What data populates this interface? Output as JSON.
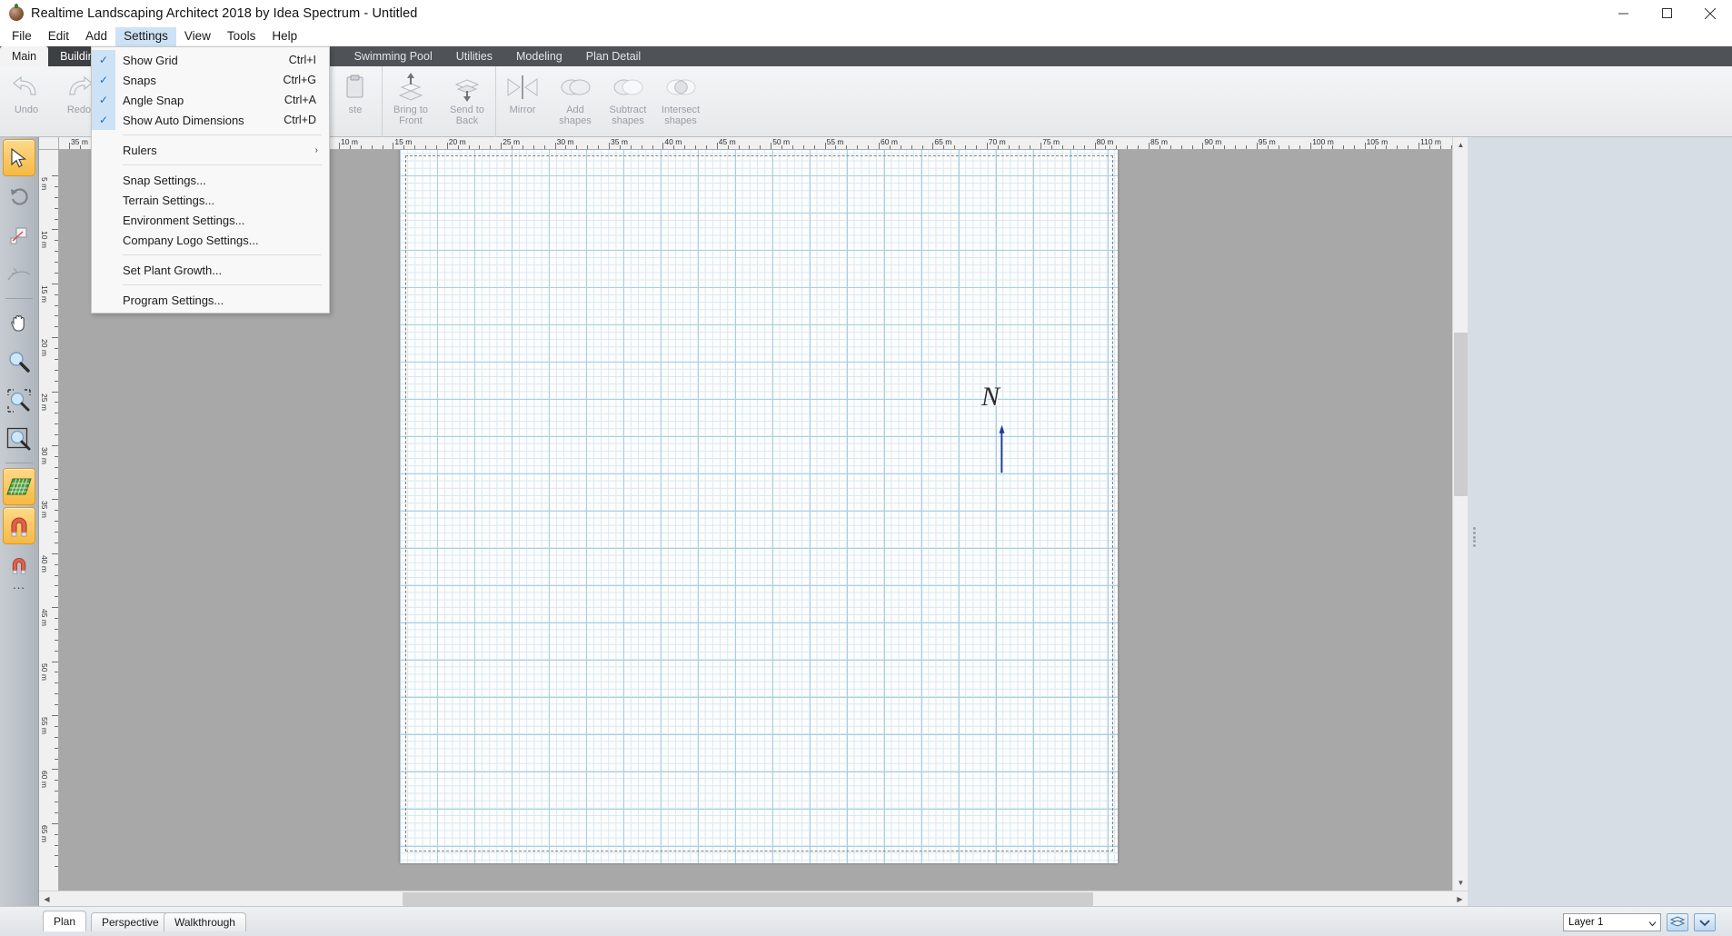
{
  "window": {
    "title": "Realtime Landscaping Architect 2018 by Idea Spectrum - Untitled",
    "app_icon": "tree-icon",
    "minimize": "─",
    "maximize": "☐",
    "close": "✕"
  },
  "menubar": {
    "items": [
      {
        "label": "File",
        "active": false
      },
      {
        "label": "Edit",
        "active": false
      },
      {
        "label": "Add",
        "active": false
      },
      {
        "label": "Settings",
        "active": true
      },
      {
        "label": "View",
        "active": false
      },
      {
        "label": "Tools",
        "active": false
      },
      {
        "label": "Help",
        "active": false
      }
    ]
  },
  "settings_menu": {
    "items": [
      {
        "label": "Show Grid",
        "accel": "Ctrl+I",
        "checked": true,
        "type": "check"
      },
      {
        "label": "Snaps",
        "accel": "Ctrl+G",
        "checked": true,
        "type": "check"
      },
      {
        "label": "Angle Snap",
        "accel": "Ctrl+A",
        "checked": true,
        "type": "check"
      },
      {
        "label": "Show Auto Dimensions",
        "accel": "Ctrl+D",
        "checked": true,
        "type": "check"
      },
      {
        "type": "separator"
      },
      {
        "label": "Rulers",
        "accel": "",
        "checked": false,
        "type": "submenu",
        "submenu_arrow": "›"
      },
      {
        "type": "separator"
      },
      {
        "label": "Snap Settings...",
        "accel": "",
        "checked": false,
        "type": "item"
      },
      {
        "label": "Terrain Settings...",
        "accel": "",
        "checked": false,
        "type": "item"
      },
      {
        "label": "Environment Settings...",
        "accel": "",
        "checked": false,
        "type": "item"
      },
      {
        "label": "Company Logo Settings...",
        "accel": "",
        "checked": false,
        "type": "item"
      },
      {
        "type": "separator"
      },
      {
        "label": "Set Plant Growth...",
        "accel": "",
        "checked": false,
        "type": "item"
      },
      {
        "type": "separator"
      },
      {
        "label": "Program Settings...",
        "accel": "",
        "checked": false,
        "type": "item"
      }
    ]
  },
  "ribbon": {
    "tabs": [
      {
        "label": "Main",
        "state": "selected"
      },
      {
        "label": "Building",
        "state": "sub"
      },
      {
        "label": "Swimming Pool",
        "state": "normal"
      },
      {
        "label": "Utilities",
        "state": "normal"
      },
      {
        "label": "Modeling",
        "state": "normal"
      },
      {
        "label": "Plan Detail",
        "state": "normal"
      }
    ],
    "groups": [
      {
        "buttons": [
          {
            "label": "Undo",
            "icon": "undo-arrow-icon"
          },
          {
            "label": "Redo",
            "icon": "redo-arrow-icon"
          }
        ]
      },
      {
        "buttons": [
          {
            "label": "Paste",
            "short_label": "ste",
            "icon": "paste-icon"
          }
        ]
      },
      {
        "buttons": [
          {
            "label": "Bring to Front",
            "line1": "Bring to",
            "line2": "Front",
            "icon": "bring-to-front-icon"
          },
          {
            "label": "Send to Back",
            "line1": "Send to",
            "line2": "Back",
            "icon": "send-to-back-icon"
          }
        ]
      },
      {
        "buttons": [
          {
            "label": "Mirror",
            "line1": "Mirror",
            "line2": "",
            "icon": "mirror-icon"
          },
          {
            "label": "Add shapes",
            "line1": "Add",
            "line2": "shapes",
            "icon": "add-shapes-icon"
          },
          {
            "label": "Subtract shapes",
            "line1": "Subtract",
            "line2": "shapes",
            "icon": "subtract-shapes-icon"
          },
          {
            "label": "Intersect shapes",
            "line1": "Intersect",
            "line2": "shapes",
            "icon": "intersect-shapes-icon"
          }
        ]
      }
    ]
  },
  "left_toolbar": {
    "tools": [
      {
        "name": "select-arrow-tool",
        "selected": true
      },
      {
        "name": "rotate-tool",
        "selected": false
      },
      {
        "name": "resize-tool",
        "selected": false
      },
      {
        "name": "curve-tool",
        "selected": false
      },
      {
        "name": "pan-hand-tool",
        "selected": false
      },
      {
        "name": "zoom-tool",
        "selected": false
      },
      {
        "name": "zoom-window-tool",
        "selected": false
      },
      {
        "name": "zoom-extents-tool",
        "selected": false
      },
      {
        "name": "grid-tool",
        "selected": true
      },
      {
        "name": "magnet-snap-tool",
        "selected": true
      },
      {
        "name": "magnet-more-tool",
        "selected": false
      }
    ],
    "more_label": "..."
  },
  "ruler_h": {
    "unit": "m",
    "labels": [
      "35 m",
      "40 m",
      "45 m",
      "50 m",
      "5 m",
      "10 m",
      "15 m",
      "20 m",
      "25 m",
      "30 m",
      "35 m",
      "40 m",
      "45 m",
      "50 m",
      "55 m",
      "60 m",
      "65 m",
      "70 m",
      "75 m",
      "80 m",
      "85 m",
      "90 m",
      "95 m",
      "100 m",
      "105 m",
      "110 m"
    ]
  },
  "ruler_v": {
    "unit": "m",
    "labels": [
      "5 m",
      "10 m",
      "15 m",
      "20 m",
      "25 m",
      "30 m",
      "35 m",
      "40 m",
      "45 m",
      "50 m",
      "55 m",
      "60 m",
      "65 m"
    ]
  },
  "canvas": {
    "compass_letter": "N",
    "compass_name": "north-compass"
  },
  "bottom": {
    "view_tabs": [
      {
        "label": "Plan",
        "active": true
      },
      {
        "label": "Perspective",
        "active": false
      },
      {
        "label": "Walkthrough",
        "active": false
      }
    ],
    "layer_value": "Layer 1",
    "layer_caret": "⌄",
    "layers_button_icon": "layers-stack-icon",
    "layers_dropdown_icon": "chevron-down-icon"
  },
  "colors": {
    "accent_blue": "#cde2f5",
    "ribbon_dark": "#4f5357",
    "canvas_gray": "#a8a8a8",
    "grid_blue": "#a9cfe2",
    "highlight_orange": "#f6b942"
  }
}
